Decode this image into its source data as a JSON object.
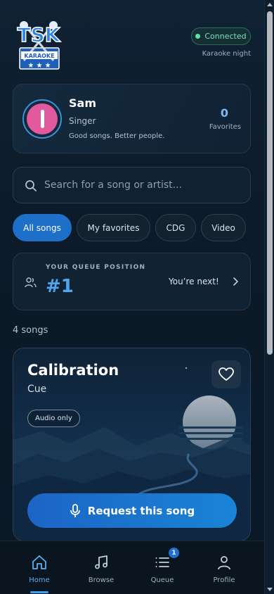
{
  "header": {
    "logo_text": "TSK",
    "logo_subtext": "KARAOKE",
    "status_label": "Connected",
    "event_name": "Karaoke night"
  },
  "profile": {
    "name": "Sam",
    "role": "Singer",
    "tagline": "Good songs. Better people.",
    "favorites_count": "0",
    "favorites_label": "Favorites"
  },
  "search": {
    "placeholder": "Search for a song or artist...",
    "value": ""
  },
  "filters": [
    {
      "label": "All songs",
      "active": true
    },
    {
      "label": "My favorites",
      "active": false
    },
    {
      "label": "CDG",
      "active": false
    },
    {
      "label": "Video",
      "active": false
    }
  ],
  "queue": {
    "label": "YOUR QUEUE POSITION",
    "position": "#1",
    "message": "You’re next!"
  },
  "songs_count_label": "4 songs",
  "song": {
    "title": "Calibration",
    "artist": "Cue",
    "badge": "Audio only",
    "request_label": "Request this song"
  },
  "nav": {
    "items": [
      {
        "label": "Home",
        "icon": "home-icon",
        "active": true
      },
      {
        "label": "Browse",
        "icon": "music-note-icon",
        "active": false
      },
      {
        "label": "Queue",
        "icon": "list-icon",
        "active": false,
        "badge": "1"
      },
      {
        "label": "Profile",
        "icon": "person-icon",
        "active": false
      }
    ]
  },
  "colors": {
    "accent": "#1d6fc8",
    "connected": "#5fe0a5",
    "avatar": "#e25a9e"
  }
}
